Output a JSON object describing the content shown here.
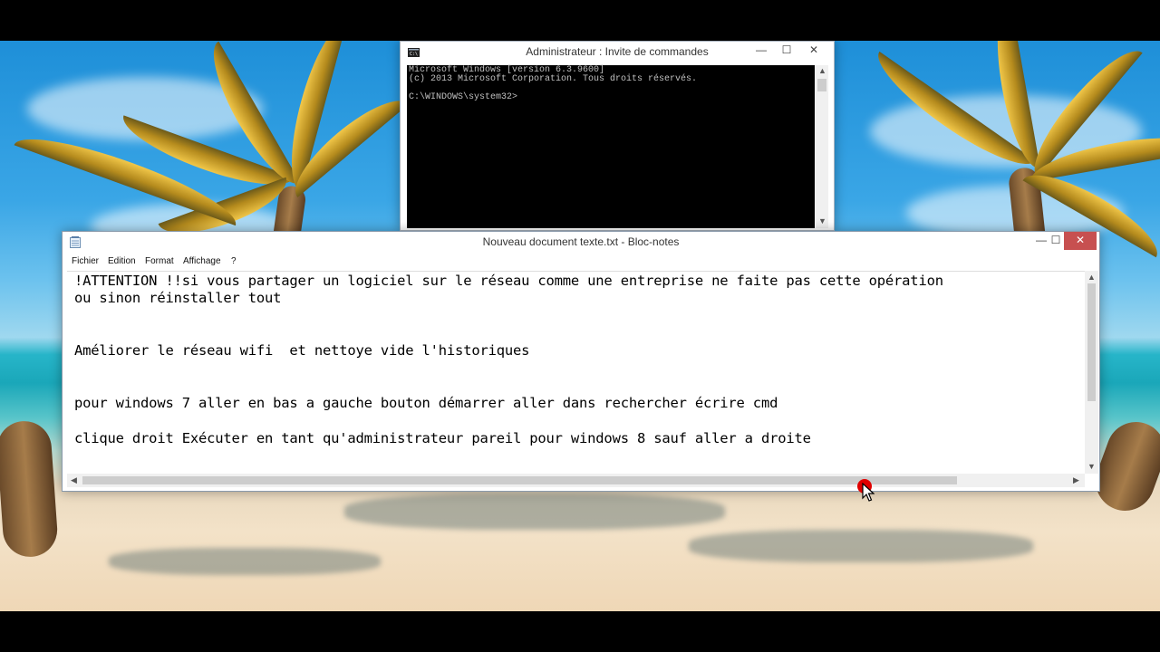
{
  "cmd_window": {
    "title": "Administrateur : Invite de commandes",
    "lines": [
      "Microsoft Windows [version 6.3.9600]",
      "(c) 2013 Microsoft Corporation. Tous droits réservés.",
      "",
      "C:\\WINDOWS\\system32>"
    ],
    "buttons": {
      "minimize": "—",
      "maximize": "☐",
      "close": "✕"
    }
  },
  "notepad": {
    "title": "Nouveau document texte.txt - Bloc-notes",
    "menu": [
      "Fichier",
      "Edition",
      "Format",
      "Affichage",
      "?"
    ],
    "buttons": {
      "minimize": "—",
      "maximize": "☐",
      "close": "✕"
    },
    "text_lines": [
      "!ATTENTION !!si vous partager un logiciel sur le réseau comme une entreprise ne faite pas cette opération",
      "ou sinon réinstaller tout",
      "",
      "",
      "Améliorer le réseau wifi  et nettoye vide l'historiques",
      "",
      "",
      "pour windows 7 aller en bas a gauche bouton démarrer aller dans rechercher écrire cmd",
      "",
      "clique droit Exécuter en tant qu'administrateur pareil pour windows 8 sauf aller a droite"
    ]
  },
  "icons": {
    "cmd": "console-icon",
    "notepad": "notepad-icon",
    "cursor": "mouse-pointer-icon"
  },
  "colors": {
    "close_button": "#c75050",
    "cursor_highlight": "#e00000"
  }
}
